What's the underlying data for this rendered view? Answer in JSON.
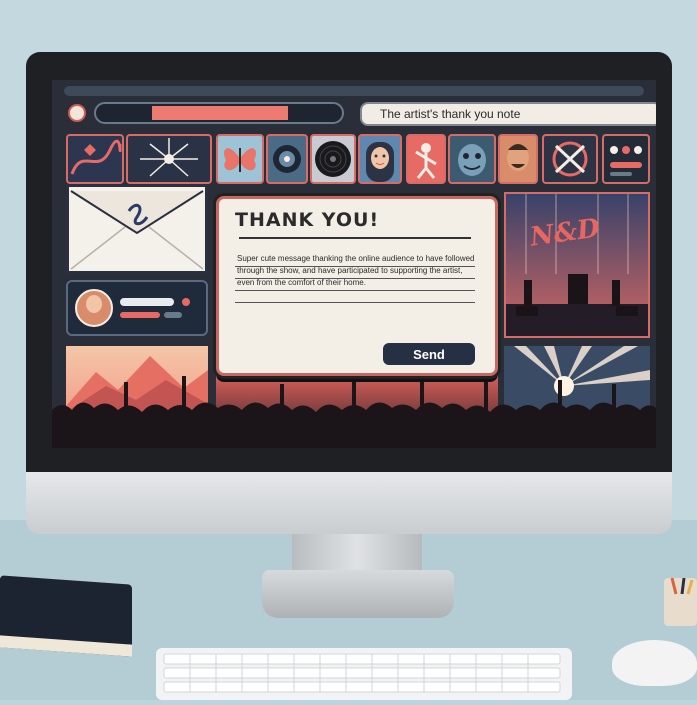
{
  "browser": {
    "title": "The artist's thank you note"
  },
  "dialog": {
    "heading": "THANK YOU!",
    "message": "Super cute message thanking the online audience to have followed through the show, and have participated to supporting the artist, even from the comfort of their home.",
    "send_label": "Send"
  },
  "concert_panel": {
    "band_logo": "N&D"
  },
  "icons": [
    "envelope-icon",
    "butterfly-icon",
    "vinyl-icon",
    "avatar-icon",
    "play-icon"
  ],
  "colors": {
    "accent": "#ef7a72",
    "screen_bg": "#2a2e38",
    "button": "#253044",
    "dialog_bg": "#f4efe6"
  }
}
